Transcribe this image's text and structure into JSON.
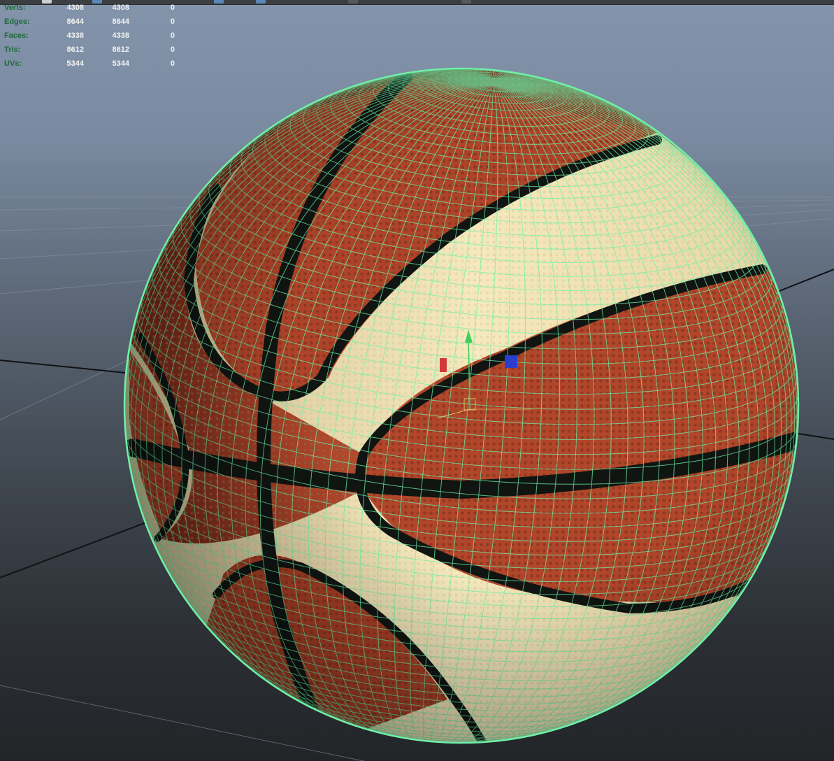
{
  "hud": {
    "rows": [
      {
        "label": "Verts:",
        "v1": "4308",
        "v2": "4308",
        "v3": "0"
      },
      {
        "label": "Edges:",
        "v1": "8644",
        "v2": "8644",
        "v3": "0"
      },
      {
        "label": "Faces:",
        "v1": "4338",
        "v2": "4338",
        "v3": "0"
      },
      {
        "label": "Tris:",
        "v1": "8612",
        "v2": "8612",
        "v3": "0"
      },
      {
        "label": "UVs:",
        "v1": "5344",
        "v2": "5344",
        "v3": "0"
      }
    ]
  },
  "colors": {
    "wireframe": "#6ff0a8",
    "leather": "#b84a2c",
    "panel": "#f0e2b0",
    "seam": "#101512",
    "gizmo_x": "#d23a3a",
    "gizmo_y": "#3ccf5a",
    "gizmo_z": "#2a3fcc"
  },
  "icons": [
    "viewport-toolbar-icon",
    "move-gizmo-icon"
  ]
}
